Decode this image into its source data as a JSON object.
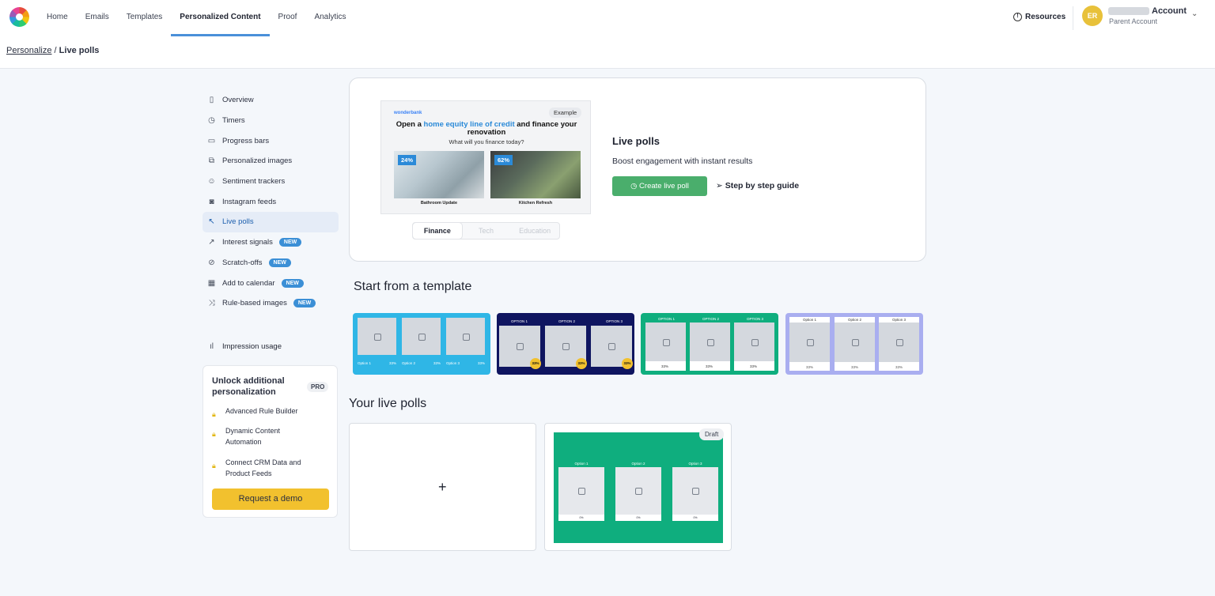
{
  "nav": {
    "items": [
      "Home",
      "Emails",
      "Templates",
      "Personalized Content",
      "Proof",
      "Analytics"
    ],
    "active_index": 3,
    "resources": "Resources",
    "avatar_initials": "ER",
    "account_name": "Account",
    "account_sub": "Parent Account"
  },
  "breadcrumb": {
    "parent": "Personalize",
    "separator": "/",
    "current": "Live polls"
  },
  "sidebar": {
    "items": [
      {
        "label": "Overview",
        "icon": "document-icon"
      },
      {
        "label": "Timers",
        "icon": "clock-icon"
      },
      {
        "label": "Progress bars",
        "icon": "progress-icon"
      },
      {
        "label": "Personalized images",
        "icon": "images-icon"
      },
      {
        "label": "Sentiment trackers",
        "icon": "smile-icon"
      },
      {
        "label": "Instagram feeds",
        "icon": "instagram-icon"
      },
      {
        "label": "Live polls",
        "icon": "cursor-icon",
        "active": true
      },
      {
        "label": "Interest signals",
        "icon": "trend-icon",
        "badge": "NEW"
      },
      {
        "label": "Scratch-offs",
        "icon": "scratch-icon",
        "badge": "NEW"
      },
      {
        "label": "Add to calendar",
        "icon": "calendar-icon",
        "badge": "NEW"
      },
      {
        "label": "Rule-based images",
        "icon": "shuffle-icon",
        "badge": "NEW"
      }
    ],
    "impression_usage": "Impression usage"
  },
  "pro_card": {
    "title": "Unlock additional personalization",
    "badge": "PRO",
    "features": [
      "Advanced Rule Builder",
      "Dynamic Content Automation",
      "Connect CRM Data and Product Feeds"
    ],
    "cta": "Request a demo"
  },
  "hero": {
    "preview": {
      "brand": "wonderbank",
      "example_badge": "Example",
      "title_pre": "Open a ",
      "title_highlight": "home equity line of credit",
      "title_post": " and finance your renovation",
      "subtitle": "What will you finance today?",
      "option1": {
        "pct": "24%",
        "label": "Bathroom Update"
      },
      "option2": {
        "pct": "62%",
        "label": "Kitchen Refresh"
      }
    },
    "tabs": [
      "Finance",
      "Tech",
      "Education"
    ],
    "active_tab": 0,
    "title": "Live polls",
    "subtitle": "Boost engagement with instant results",
    "create_button": "Create live poll",
    "guide_link": "Step by step guide"
  },
  "templates_heading": "Start from a template",
  "templates": [
    {
      "bg": "#2fb6e6",
      "labels": [
        "Option 1",
        "Option 2",
        "Option 3"
      ],
      "pcts": [
        "33%",
        "33%",
        "33%"
      ]
    },
    {
      "bg": "#0f1560",
      "labels": [
        "OPTION 1",
        "OPTION 2",
        "OPTION 3"
      ],
      "pcts": [
        "33%",
        "33%",
        "33%"
      ]
    },
    {
      "bg": "#0fae7e",
      "labels": [
        "OPTION 1",
        "OPTION 2",
        "OPTION 3"
      ],
      "pcts": [
        "33%",
        "33%",
        "33%"
      ]
    },
    {
      "bg": "#a9aef0",
      "labels": [
        "Option 1",
        "Option 2",
        "Option 3"
      ],
      "pcts": [
        "33%",
        "33%",
        "33%"
      ]
    }
  ],
  "polls_heading": "Your live polls",
  "draft_poll": {
    "badge": "Draft",
    "labels": [
      "Option 1",
      "Option 2",
      "Option 3"
    ],
    "pcts": [
      "0%",
      "0%",
      "0%"
    ]
  },
  "colors": {
    "accent": "#4a90d9",
    "create_green": "#4aae6c",
    "demo_yellow": "#f2c12e",
    "new_badge": "#3b8fd6"
  }
}
